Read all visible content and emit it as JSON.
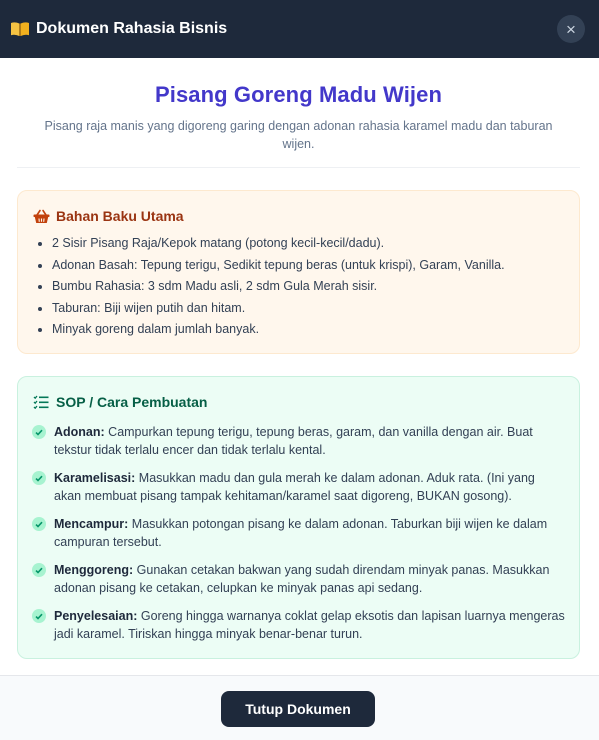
{
  "modal": {
    "title": "Dokumen Rahasia Bisnis",
    "close_symbol": "×"
  },
  "document": {
    "title": "Pisang Goreng Madu Wijen",
    "subtitle": "Pisang raja manis yang digoreng garing dengan adonan rahasia karamel madu dan taburan wijen."
  },
  "bahan": {
    "heading": "Bahan Baku Utama",
    "items": [
      "2 Sisir Pisang Raja/Kepok matang (potong kecil-kecil/dadu).",
      "Adonan Basah: Tepung terigu, Sedikit tepung beras (untuk krispi), Garam, Vanilla.",
      "Bumbu Rahasia: 3 sdm Madu asli, 2 sdm Gula Merah sisir.",
      "Taburan: Biji wijen putih dan hitam.",
      "Minyak goreng dalam jumlah banyak."
    ]
  },
  "sop": {
    "heading": "SOP / Cara Pembuatan",
    "steps": [
      {
        "label": "Adonan:",
        "text": " Campurkan tepung terigu, tepung beras, garam, dan vanilla dengan air. Buat tekstur tidak terlalu encer dan tidak terlalu kental."
      },
      {
        "label": "Karamelisasi:",
        "text": " Masukkan madu dan gula merah ke dalam adonan. Aduk rata. (Ini yang akan membuat pisang tampak kehitaman/karamel saat digoreng, BUKAN gosong)."
      },
      {
        "label": "Mencampur:",
        "text": " Masukkan potongan pisang ke dalam adonan. Taburkan biji wijen ke dalam campuran tersebut."
      },
      {
        "label": "Menggoreng:",
        "text": " Gunakan cetakan bakwan yang sudah direndam minyak panas. Masukkan adonan pisang ke cetakan, celupkan ke minyak panas api sedang."
      },
      {
        "label": "Penyelesaian:",
        "text": " Goreng hingga warnanya coklat gelap eksotis dan lapisan luarnya mengeras jadi karamel. Tiriskan hingga minyak benar-benar turun."
      }
    ]
  },
  "footer": {
    "button_label": "Tutup Dokumen"
  },
  "colors": {
    "header_bg": "#1e293b",
    "title_accent": "#4338ca",
    "bahan_heading": "#9a3412",
    "sop_heading": "#065f46",
    "check_green": "#10b981"
  },
  "icons": {
    "header": "open-book-icon",
    "close": "close-icon",
    "bahan": "basket-icon",
    "sop": "list-icon",
    "step": "check-circle-icon"
  }
}
